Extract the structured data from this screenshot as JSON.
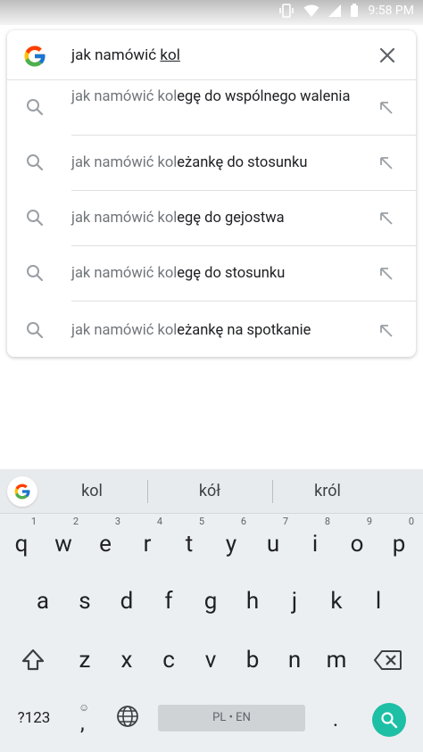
{
  "status": {
    "time": "9:58 PM"
  },
  "search": {
    "query_plain": "jak namówić ",
    "query_underlined": "kol"
  },
  "suggestions": [
    {
      "typed": "jak namówić kol",
      "rest": "egę do wspólnego walenia"
    },
    {
      "typed": "jak namówić kol",
      "rest": "eżankę do stosunku"
    },
    {
      "typed": "jak namówić kol",
      "rest": "egę do gejostwa"
    },
    {
      "typed": "jak namówić kol",
      "rest": "egę do stosunku"
    },
    {
      "typed": "jak namówić kol",
      "rest": "eżankę na spotkanie"
    }
  ],
  "keyboard": {
    "word_suggestions": [
      "kol",
      "kół",
      "król"
    ],
    "row1": [
      {
        "k": "q",
        "h": "1"
      },
      {
        "k": "w",
        "h": "2"
      },
      {
        "k": "e",
        "h": "3"
      },
      {
        "k": "r",
        "h": "4"
      },
      {
        "k": "t",
        "h": "5"
      },
      {
        "k": "y",
        "h": "6"
      },
      {
        "k": "u",
        "h": "7"
      },
      {
        "k": "i",
        "h": "8"
      },
      {
        "k": "o",
        "h": "9"
      },
      {
        "k": "p",
        "h": "0"
      }
    ],
    "row2": [
      "a",
      "s",
      "d",
      "f",
      "g",
      "h",
      "j",
      "k",
      "l"
    ],
    "row3": [
      "z",
      "x",
      "c",
      "v",
      "b",
      "n",
      "m"
    ],
    "symbols_label": "?123",
    "comma": ",",
    "space_label": "PL • EN",
    "period": "."
  }
}
